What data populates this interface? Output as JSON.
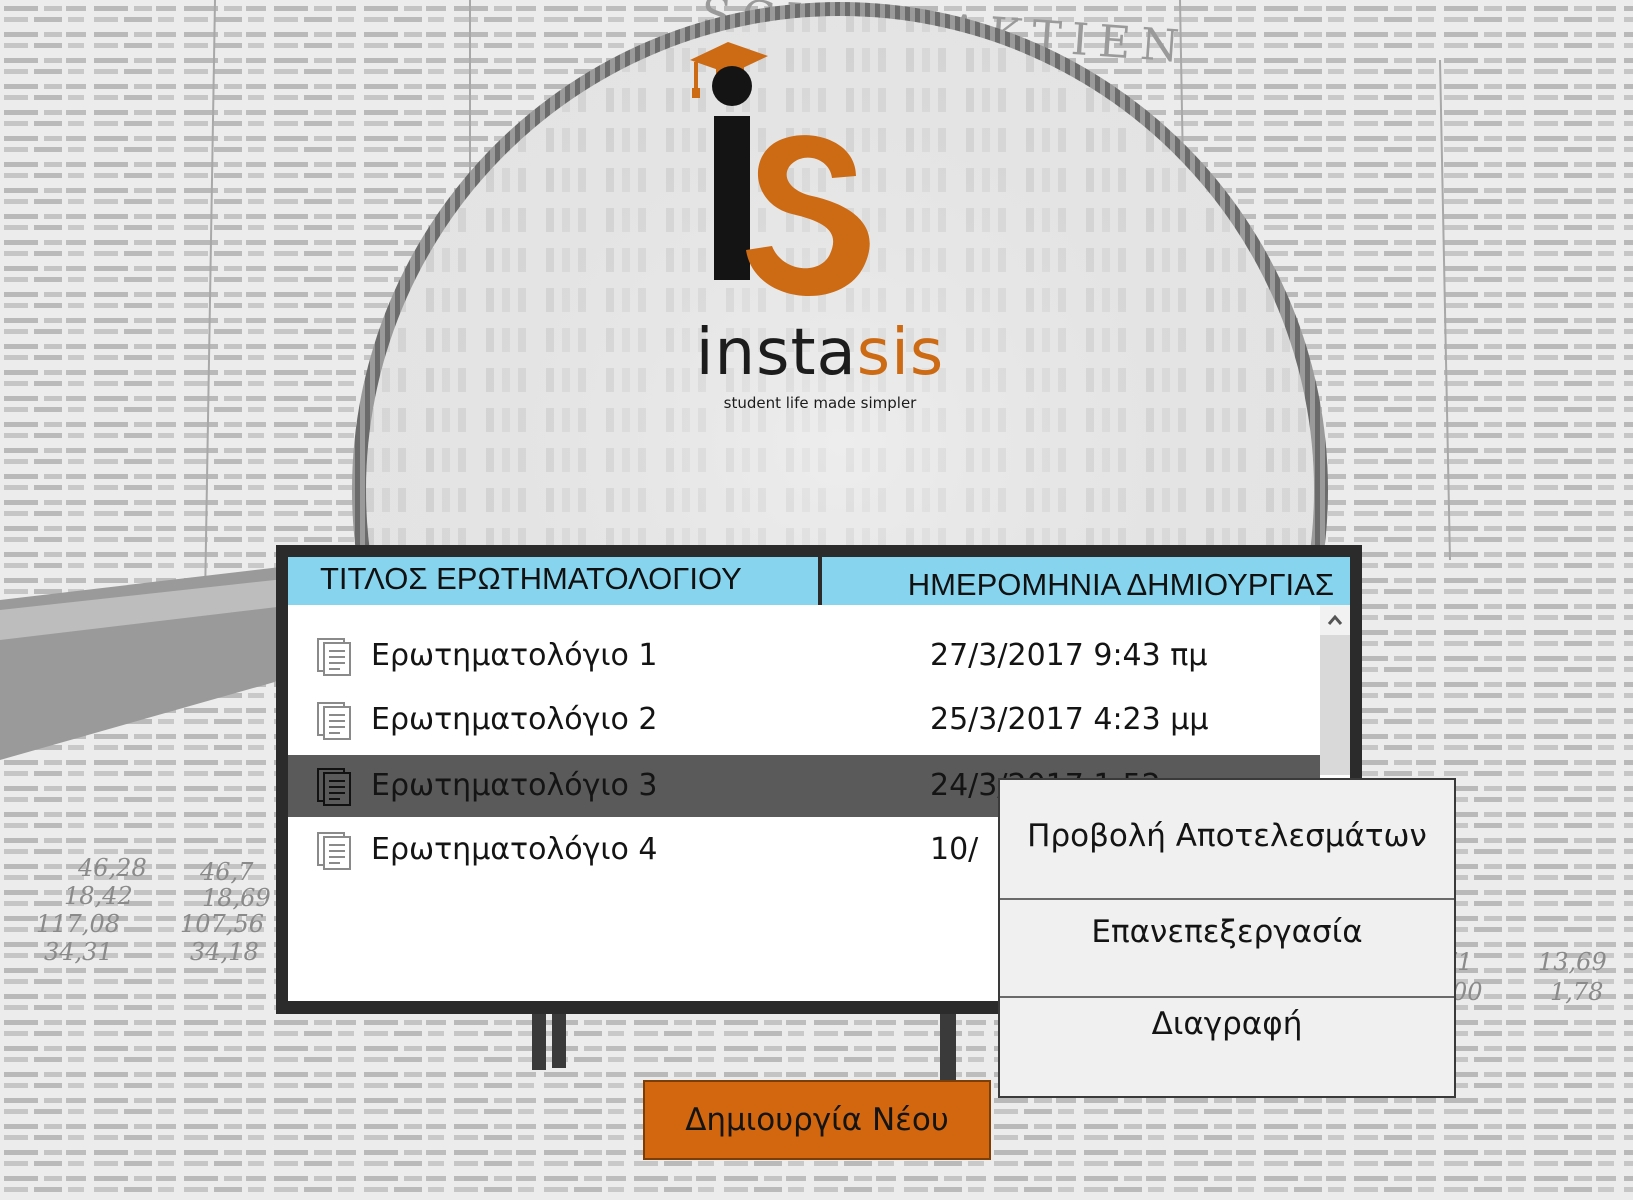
{
  "brand": {
    "name_part1": "insta",
    "name_part2": "sis",
    "tagline": "student life made simpler",
    "colors": {
      "orange": "#cd6a14",
      "dark": "#1c1c1c"
    }
  },
  "background": {
    "newspaper_heading": "SCHEN AKTIEN"
  },
  "table": {
    "columns": {
      "title": "ΤΙΤΛΟΣ ΕΡΩΤΗΜΑΤΟΛΟΓΙΟΥ",
      "date": "ΗΜΕΡΟΜΗΝΙΑ ΔΗΜΙΟΥΡΓΙΑΣ"
    },
    "header_color": "#87d4ee",
    "rows": [
      {
        "icon": "document-icon",
        "title": "Ερωτηματολόγιο 1",
        "date": "27/3/2017 9:43 πμ",
        "selected": false
      },
      {
        "icon": "document-icon",
        "title": "Ερωτηματολόγιο 2",
        "date": "25/3/2017 4:23 μμ",
        "selected": false
      },
      {
        "icon": "document-icon",
        "title": "Ερωτηματολόγιο 3",
        "date": "24/3/2017 1:52",
        "selected": true
      },
      {
        "icon": "document-icon",
        "title": "Ερωτηματολόγιο 4",
        "date": "10/",
        "selected": false
      }
    ]
  },
  "context_menu": {
    "items": [
      "Προβολή Αποτελεσμάτων",
      "Επανεπεξεργασία",
      "Διαγραφή"
    ]
  },
  "actions": {
    "create_label": "Δημιουργία Νέου",
    "create_color": "#d2670f"
  }
}
